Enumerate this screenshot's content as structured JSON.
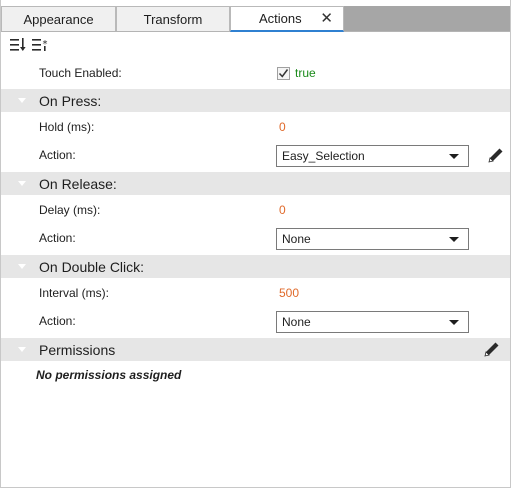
{
  "tabs": [
    {
      "label": "Appearance",
      "active": false
    },
    {
      "label": "Transform",
      "active": false
    },
    {
      "label": "Actions",
      "active": true
    }
  ],
  "toolbar": {
    "sort_icon": "sort-descending-icon",
    "sort_alt_icon": "sort-asterisk-icon"
  },
  "touch": {
    "label": "Touch Enabled:",
    "checked": true,
    "value": "true"
  },
  "on_press": {
    "title": "On Press:",
    "hold_label": "Hold (ms):",
    "hold_value": "0",
    "action_label": "Action:",
    "action_value": "Easy_Selection"
  },
  "on_release": {
    "title": "On Release:",
    "delay_label": "Delay (ms):",
    "delay_value": "0",
    "action_label": "Action:",
    "action_value": "None"
  },
  "on_double_click": {
    "title": "On Double Click:",
    "interval_label": "Interval (ms):",
    "interval_value": "500",
    "action_label": "Action:",
    "action_value": "None"
  },
  "permissions": {
    "title": "Permissions",
    "empty_text": "No permissions assigned"
  },
  "colors": {
    "accent": "#2f80d1",
    "value_orange": "#e06a2b",
    "value_green": "#1a8a1a",
    "section_bg": "#e6e6e6"
  }
}
